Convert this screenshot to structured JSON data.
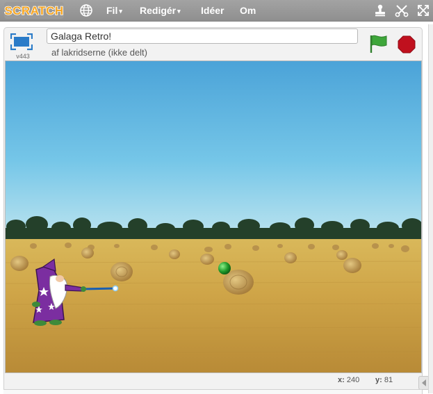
{
  "menubar": {
    "logo_text": "SCRATCH",
    "menus": [
      {
        "label": "Fil",
        "has_caret": true
      },
      {
        "label": "Redigér",
        "has_caret": true
      },
      {
        "label": "Idéer",
        "has_caret": false
      },
      {
        "label": "Om",
        "has_caret": false
      }
    ],
    "caret": "▾",
    "icons": [
      "globe-icon",
      "stamp-icon",
      "scissors-icon",
      "fullscreen-icon"
    ],
    "colors": {
      "bar": "#9a9a9a",
      "menu_text": "#ffffff",
      "logo": "#f6a623"
    }
  },
  "stage_header": {
    "project_title": "Galaga Retro!",
    "byline": "af lakridserne (ikke delt)",
    "version": "v443",
    "icons": [
      "presentation-mode-icon",
      "green-flag-icon",
      "stop-icon"
    ],
    "colors": {
      "flag": "#3ea63a",
      "stop": "#c0101e",
      "presentation": "#2a7bc8"
    }
  },
  "stage": {
    "backdrop": "hay-bale field under blue sky",
    "sprites": [
      "wizard-sprite",
      "green-orb-sprite"
    ]
  },
  "readout": {
    "x_label": "x:",
    "x_value": "240",
    "y_label": "y:",
    "y_value": "81"
  }
}
